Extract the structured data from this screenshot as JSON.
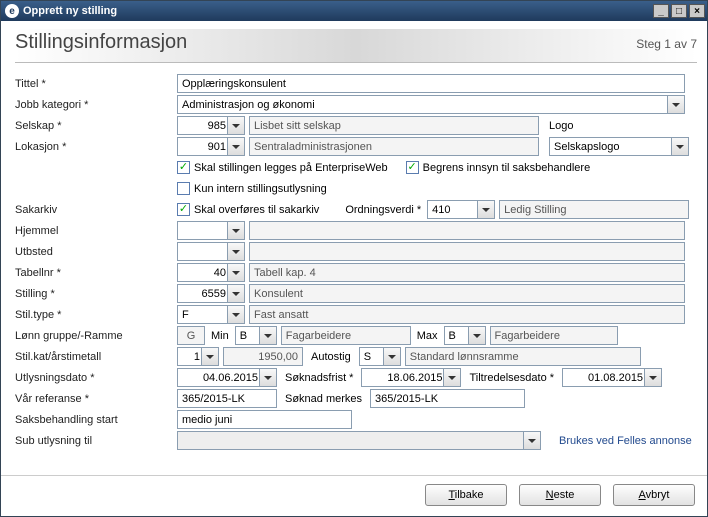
{
  "window": {
    "title": "Opprett ny stilling",
    "icon_letter": "e"
  },
  "header": {
    "title": "Stillingsinformasjon",
    "step": "Steg 1 av 7"
  },
  "labels": {
    "tittel": "Tittel *",
    "jobbkat": "Jobb kategori *",
    "selskap": "Selskap *",
    "lokasjon": "Lokasjon *",
    "sakarkiv": "Sakarkiv",
    "hjemmel": "Hjemmel",
    "utbsted": "Utbsted",
    "tabellnr": "Tabellnr *",
    "stilling": "Stilling *",
    "stiltype": "Stil.type *",
    "lonngruppe": "Lønn gruppe/-Ramme",
    "stilkat": "Stil.kat/årstimetall",
    "utlysningsdato": "Utlysningsdato *",
    "varref": "Vår referanse *",
    "saksbehandlingstart": "Saksbehandling start",
    "subutlysning": "Sub utlysning til",
    "logo": "Logo",
    "ordningsverdi": "Ordningsverdi *",
    "min": "Min",
    "max": "Max",
    "autostig": "Autostig",
    "soknadsfrist": "Søknadsfrist *",
    "tiltredelsesdato": "Tiltredelsesdato *",
    "soknadmerkes": "Søknad merkes",
    "brukesfelles": "Brukes ved Felles annonse"
  },
  "values": {
    "tittel": "Opplæringskonsulent",
    "jobbkat": "Administrasjon og økonomi",
    "selskap": "985",
    "selskap_desc": "Lisbet sitt selskap",
    "lokasjon": "901",
    "lokasjon_desc": "Sentraladministrasjonen",
    "logo": "Selskapslogo",
    "chk_eweb": "Skal stillingen legges på EnterpriseWeb",
    "chk_begrens": "Begrens innsyn til saksbehandlere",
    "chk_intern": "Kun intern stillingsutlysning",
    "chk_sakarkiv": "Skal overføres til sakarkiv",
    "ordningsverdi": "410",
    "ordningsverdi_desc": "Ledig Stilling",
    "tabellnr": "40",
    "tabellnr_desc": "Tabell kap. 4",
    "stilling": "6559",
    "stilling_desc": "Konsulent",
    "stiltype": "F",
    "stiltype_desc": "Fast ansatt",
    "lonn_g": "G",
    "lonn_min_b": "B",
    "lonn_min_desc": "Fagarbeidere",
    "lonn_max_b": "B",
    "lonn_max_desc": "Fagarbeidere",
    "stilkat": "1",
    "stilkat_amount": "1950,00",
    "autostig": "S",
    "autostig_desc": "Standard lønnsramme",
    "utlysningsdato": "04.06.2015",
    "soknadsfrist": "18.06.2015",
    "tiltredelsesdato": "01.08.2015",
    "varref": "365/2015-LK",
    "soknadmerkes": "365/2015-LK",
    "saksbehandlingstart": "medio juni"
  },
  "buttons": {
    "tilbake": "Tilbake",
    "neste": "Neste",
    "avbryt": "Avbryt"
  }
}
